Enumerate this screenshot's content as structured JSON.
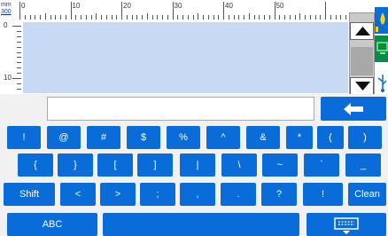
{
  "ruler": {
    "unit_top": "mm",
    "unit_bottom": "300",
    "top_labels": [
      "0",
      "10",
      "20",
      "30",
      "40",
      "50"
    ],
    "left_labels": [
      "0",
      "10"
    ]
  },
  "editor": {
    "text": ""
  },
  "input": {
    "value": ""
  },
  "keyboard": {
    "row1": [
      "!",
      "@",
      "#",
      "$",
      "%",
      "^",
      "&",
      "*",
      "(",
      ")"
    ],
    "row2": [
      "{",
      "}",
      "[",
      "]",
      "|",
      "\\",
      "~",
      "`",
      "_"
    ],
    "row3": [
      "Shift",
      "<",
      ">",
      ";",
      ",",
      ".",
      "?",
      "!",
      "Clean"
    ],
    "row4_left": "ABC",
    "row4_space": ""
  },
  "icons": {
    "backspace": "backspace-arrow-icon",
    "keyboard_toggle": "keyboard-icon",
    "ink": "ink-drop-icon",
    "monitor": "monitor-icon",
    "usb": "usb-icon"
  },
  "colors": {
    "key_blue": "#0a6cd8",
    "editor_bg": "#c8daf3",
    "ruler_text": "#0a33b8"
  }
}
